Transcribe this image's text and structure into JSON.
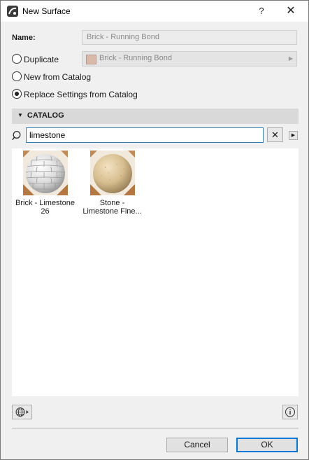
{
  "window": {
    "title": "New Surface",
    "help_label": "?",
    "close_label": "✕"
  },
  "name": {
    "label": "Name:",
    "value": "Brick - Running Bond"
  },
  "options": {
    "duplicate_label": "Duplicate",
    "duplicate_value": "Brick - Running Bond",
    "new_from_catalog_label": "New from Catalog",
    "replace_label": "Replace Settings from Catalog",
    "selected": "replace"
  },
  "catalog": {
    "header": "CATALOG",
    "search_value": "limestone",
    "clear_label": "✕",
    "items": [
      {
        "label": "Brick - Limestone 26",
        "line1": "Brick - Limestone",
        "line2": "26",
        "icon": "brick-sphere"
      },
      {
        "label": "Stone - Limestone Fine...",
        "line1": "Stone -",
        "line2": "Limestone Fine...",
        "icon": "stone-sphere"
      }
    ]
  },
  "footer": {
    "cancel_label": "Cancel",
    "ok_label": "OK"
  },
  "colors": {
    "accent": "#0078d7",
    "catalog_header_bg": "#d9d9d9",
    "duplicate_swatch": "#d9b9a9"
  }
}
